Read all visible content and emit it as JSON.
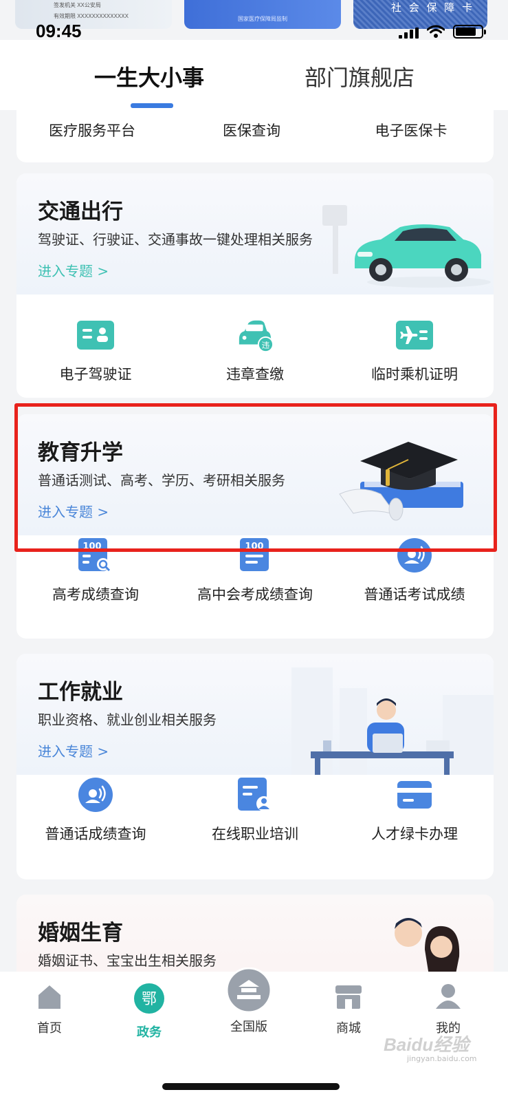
{
  "peek_cards": {
    "left_lines": [
      "签发机关 XX公安局",
      "有效期限 XXXXXXXXXXXXXX"
    ],
    "middle": "国家医疗保障局监制",
    "right": "社 会 保 障 卡"
  },
  "status": {
    "time": "09:45"
  },
  "tabs": [
    {
      "label": "一生大小事"
    },
    {
      "label": "部门旗舰店"
    }
  ],
  "top_card": {
    "items": [
      "医疗服务平台",
      "医保查询",
      "电子医保卡"
    ]
  },
  "sections": [
    {
      "title": "交通出行",
      "subtitle": "驾驶证、行驶证、交通事故一键处理相关服务",
      "link": "进入专题 >",
      "link_color": "#3fc1b3",
      "services": [
        {
          "label": "电子驾驶证",
          "icon": "license-card-icon"
        },
        {
          "label": "违章查缴",
          "icon": "car-violation-icon",
          "badge": "违"
        },
        {
          "label": "临时乘机证明",
          "icon": "flight-pass-icon"
        }
      ]
    },
    {
      "title": "教育升学",
      "subtitle": "普通话测试、高考、学历、考研相关服务",
      "link": "进入专题 >",
      "link_color": "#4a86d8",
      "services": [
        {
          "label": "高考成绩查询",
          "icon": "score-search-icon",
          "badge": "100"
        },
        {
          "label": "高中会考成绩查询",
          "icon": "score-sheet-icon",
          "badge": "100"
        },
        {
          "label": "普通话考试成绩",
          "icon": "speech-icon"
        }
      ]
    },
    {
      "title": "工作就业",
      "subtitle": "职业资格、就业创业相关服务",
      "link": "进入专题 >",
      "link_color": "#4a86d8",
      "services": [
        {
          "label": "普通话成绩查询",
          "icon": "speech-icon"
        },
        {
          "label": "在线职业培训",
          "icon": "training-icon"
        },
        {
          "label": "人才绿卡办理",
          "icon": "green-card-icon"
        }
      ]
    },
    {
      "title": "婚姻生育",
      "subtitle": "婚姻证书、宝宝出生相关服务"
    }
  ],
  "nav": [
    {
      "label": "首页",
      "icon": "home-icon"
    },
    {
      "label": "政务",
      "icon": "gov-icon",
      "glyph": "鄂"
    },
    {
      "label": "全国版",
      "icon": "national-icon"
    },
    {
      "label": "商城",
      "icon": "store-icon"
    },
    {
      "label": "我的",
      "icon": "profile-icon"
    }
  ],
  "watermark": {
    "main": "Baidu经验",
    "sub": "jingyan.baidu.com"
  },
  "colors": {
    "accent": "#3a7be0",
    "teal": "#3fc1b3",
    "highlight": "#e8221c",
    "active_nav": "#21b3a2"
  }
}
